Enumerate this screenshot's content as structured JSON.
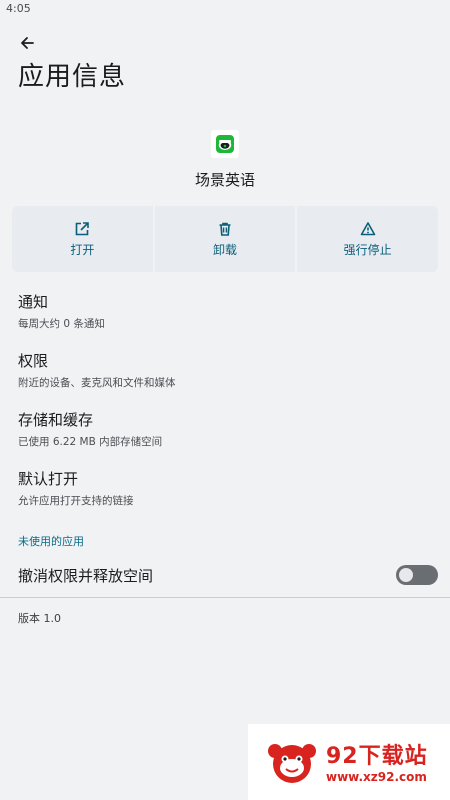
{
  "status_bar": {
    "time": "4:05"
  },
  "header": {
    "title": "应用信息"
  },
  "app": {
    "name": "场景英语"
  },
  "actions": [
    {
      "label": "打开",
      "icon": "open-in-new-icon"
    },
    {
      "label": "卸载",
      "icon": "trash-icon"
    },
    {
      "label": "强行停止",
      "icon": "warning-icon"
    }
  ],
  "settings": [
    {
      "title": "通知",
      "subtitle": "每周大约 0 条通知"
    },
    {
      "title": "权限",
      "subtitle": "附近的设备、麦克风和文件和媒体"
    },
    {
      "title": "存储和缓存",
      "subtitle": "已使用 6.22 MB 内部存储空间"
    },
    {
      "title": "默认打开",
      "subtitle": "允许应用打开支持的链接"
    }
  ],
  "unused_section": {
    "header": "未使用的应用",
    "toggle_label": "撤消权限并释放空间",
    "toggle_on": false
  },
  "version": "版本 1.0",
  "watermark": {
    "title": "92下载站",
    "url": "www.xz92.com"
  },
  "colors": {
    "accent": "#0b5f7a",
    "background": "#f1f2f4",
    "action_bg": "#e8ebef",
    "app_icon_green": "#1fb63a",
    "watermark_red": "#d8231f"
  }
}
